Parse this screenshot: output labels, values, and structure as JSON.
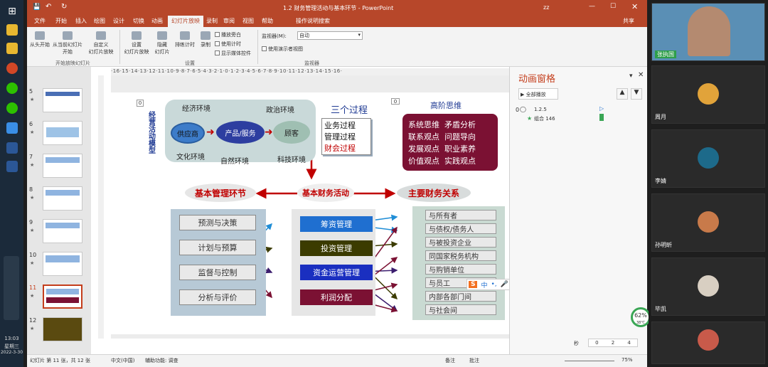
{
  "window": {
    "title": "1.2 财务管理活动与基本环节 - PowerPoint",
    "user": "zz",
    "share": "共享",
    "search": "操作说明搜索"
  },
  "ribbon_tabs": [
    "文件",
    "开始",
    "插入",
    "绘图",
    "设计",
    "切换",
    "动画",
    "幻灯片放映",
    "录制",
    "审阅",
    "视图",
    "帮助"
  ],
  "active_tab": "幻灯片放映",
  "ribbon": {
    "b1": "从头开始",
    "b2a": "从当前幻灯片",
    "b2b": "开始",
    "b3a": "自定义",
    "b3b": "幻灯片放映",
    "g1": "开始放映幻灯片",
    "b4a": "设置",
    "b4b": "幻灯片放映",
    "b5a": "隐藏",
    "b5b": "幻灯片",
    "b6": "排练计时",
    "b7": "录制",
    "c1": "播放旁白",
    "c2": "使用计时",
    "c3": "显示媒体控件",
    "g2": "设置",
    "monitor_label": "监视器(M):",
    "monitor_value": "自动",
    "c4": "使用演示者视图",
    "g3": "监视器"
  },
  "thumbs": {
    "nums": [
      "5",
      "6",
      "7",
      "8",
      "9",
      "10",
      "11",
      "12"
    ],
    "star": "★"
  },
  "ruler": "·16·15·14·13·12·11·10·9·8·7·6·5·4·3·2·1·0·1·2·3·4·5·6·7·8·9·10·11·12·13·14·15·16·",
  "slide": {
    "zero": "0",
    "vertical_title": "经营活动模型",
    "env_top_left": "经济环境",
    "env_top_right": "政治环境",
    "env_bottom_left": "文化环境",
    "env_bottom_mid": "自然环境",
    "env_bottom_right": "科技环境",
    "supplier": "供应商",
    "product": "产品/服务",
    "customer": "顾客",
    "three_title": "三个过程",
    "three_1": "业务过程",
    "three_2": "管理过程",
    "three_3": "财会过程",
    "high_title": "高阶思维",
    "high_1": "系统思维  矛盾分析",
    "high_2": "联系观点  问题导向",
    "high_3": "发展观点  职业素养",
    "high_4": "价值观点  实践观点",
    "basic_mgmt": "基本管理环节",
    "basic_fin": "基本财务活动",
    "main_rel": "主要财务关系",
    "left_items": [
      "预测与决策",
      "计划与预算",
      "监督与控制",
      "分析与评价"
    ],
    "mid_items": [
      "筹资管理",
      "投资管理",
      "资金运营管理",
      "利润分配"
    ],
    "right_items": [
      "与所有者",
      "与债权/债务人",
      "与被投资企业",
      "同国家税务机构",
      "与购销单位",
      "与员工",
      "内部各部门间",
      "与社会间"
    ]
  },
  "ime": {
    "s": "S",
    "zh": "中"
  },
  "animation": {
    "title": "动画窗格",
    "play_all": "全部播放",
    "item_num": "0",
    "item_time": "1.2.5",
    "item_sub": "组合 146",
    "seconds": "秒",
    "scale": [
      "0",
      "2",
      "4"
    ]
  },
  "status": {
    "slide": "幻灯片 第 11 张，共 12 张",
    "lang": "中文(中国)",
    "access": "辅助功能: 调查",
    "notes": "备注",
    "comments": "批注",
    "zoom": "75%"
  },
  "taskbar": {
    "time": "13:03",
    "weekday": "星期三",
    "date": "2022-3-30"
  },
  "perf": {
    "pct": "62",
    "unit": "%",
    "temp": "38℃"
  },
  "participants": [
    "张执国",
    "周月",
    "李婧",
    "孙明昕",
    "毕凯"
  ]
}
